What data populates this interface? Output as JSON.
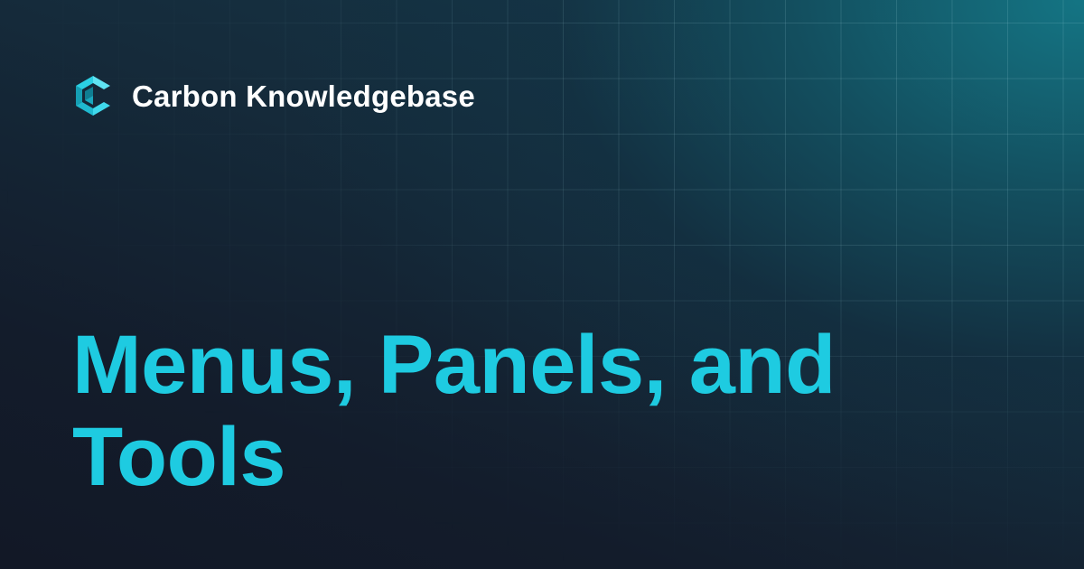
{
  "brand": {
    "name": "Carbon Knowledgebase",
    "logo_icon": "carbon-hexagon-c-icon",
    "logo_color": "#1ecbe1"
  },
  "title": "Menus, Panels, and Tools",
  "colors": {
    "background": "#121826",
    "accent": "#1ecbe1",
    "text": "#ffffff",
    "glow": "#147887"
  }
}
